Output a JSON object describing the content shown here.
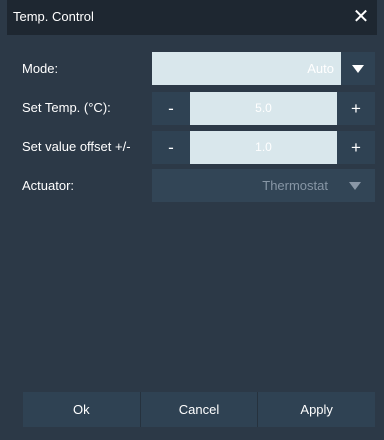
{
  "window": {
    "title": "Temp. Control",
    "close_glyph": "✕"
  },
  "form": {
    "mode": {
      "label": "Mode:",
      "value": "Auto"
    },
    "set_temp": {
      "label": "Set Temp. (°C):",
      "value": "5.0",
      "minus": "-",
      "plus": "+"
    },
    "offset": {
      "label": "Set value offset +/-",
      "value": "1.0",
      "minus": "-",
      "plus": "+"
    },
    "actuator": {
      "label": "Actuator:",
      "value": "Thermostat"
    }
  },
  "footer": {
    "ok": "Ok",
    "cancel": "Cancel",
    "apply": "Apply"
  },
  "colors": {
    "background": "#2c3947",
    "titlebar": "#1e2731",
    "field": "#d9e7ec",
    "button": "#2f4253"
  },
  "icons": {
    "close": "close-icon",
    "dropdown": "chevron-down-icon"
  }
}
